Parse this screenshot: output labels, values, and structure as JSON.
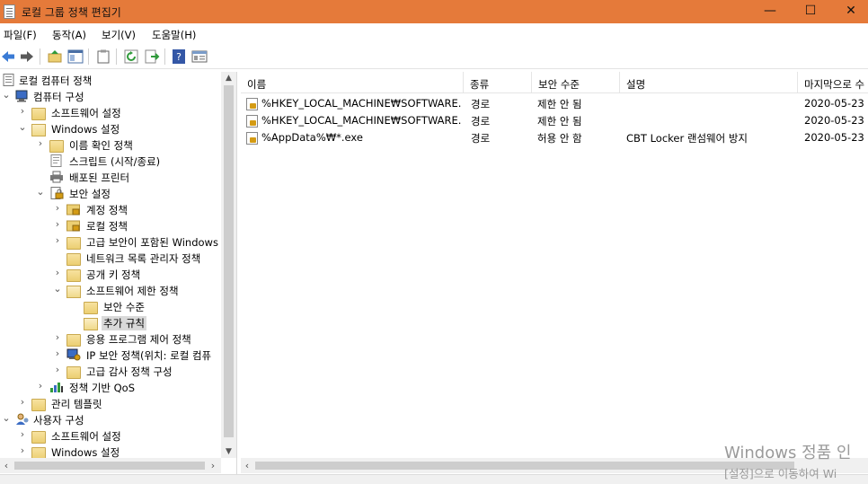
{
  "window": {
    "title": "로컬 그룹 정책 편집기",
    "minimize": "—",
    "maximize": "☐",
    "close": "✕"
  },
  "menu": {
    "file": "파일(F)",
    "action": "동작(A)",
    "view": "보기(V)",
    "help": "도움말(H)"
  },
  "toolbar": {
    "icons": [
      "back-arrow-icon",
      "forward-arrow-icon",
      "up-folder-icon",
      "show-hide-tree-icon",
      "clipboard-icon",
      "refresh-icon",
      "export-list-icon",
      "help-icon",
      "properties-icon"
    ]
  },
  "tree": {
    "root": "로컬 컴퓨터 정책",
    "computer_config": "컴퓨터 구성",
    "software_settings": "소프트웨어 설정",
    "windows_settings": "Windows 설정",
    "name_resolution": "이름 확인 정책",
    "scripts": "스크립트 (시작/종료)",
    "printers": "배포된 프린터",
    "security_settings": "보안 설정",
    "account_policy": "계정 정책",
    "local_policy": "로컬 정책",
    "advanced_firewall": "고급 보안이 포함된 Windows",
    "network_list": "네트워크 목록 관리자 정책",
    "public_key": "공개 키 정책",
    "software_restriction": "소프트웨어 제한 정책",
    "security_levels": "보안 수준",
    "additional_rules": "추가 규칙",
    "app_control": "응용 프로그램 제어 정책",
    "ip_security": "IP 보안 정책(위치: 로컬 컴퓨",
    "advanced_audit": "고급 감사 정책 구성",
    "qos": "정책 기반 QoS",
    "admin_templates": "관리 템플릿",
    "user_config": "사용자 구성",
    "user_software_settings": "소프트웨어 설정",
    "user_windows_settings": "Windows 설정"
  },
  "list": {
    "columns": {
      "name": "이름",
      "type": "종류",
      "security_level": "보안 수준",
      "description": "설명",
      "last_modified": "마지막으로 수"
    },
    "rows": [
      {
        "name": "%HKEY_LOCAL_MACHINE₩SOFTWARE...",
        "type": "경로",
        "level": "제한 안 됨",
        "description": "",
        "date": "2020-05-23"
      },
      {
        "name": "%HKEY_LOCAL_MACHINE₩SOFTWARE...",
        "type": "경로",
        "level": "제한 안 됨",
        "description": "",
        "date": "2020-05-23"
      },
      {
        "name": "%AppData%₩*.exe",
        "type": "경로",
        "level": "허용 안 함",
        "description": "CBT Locker 랜섬웨어 방지",
        "date": "2020-05-23"
      }
    ]
  },
  "watermark": {
    "line1": "Windows 정품 인",
    "line2": "[설정]으로 이동하여 Wi"
  },
  "colors": {
    "titlebar": "#e57a3a",
    "folder": "#eccf72",
    "selection": "#d9d9d9"
  }
}
